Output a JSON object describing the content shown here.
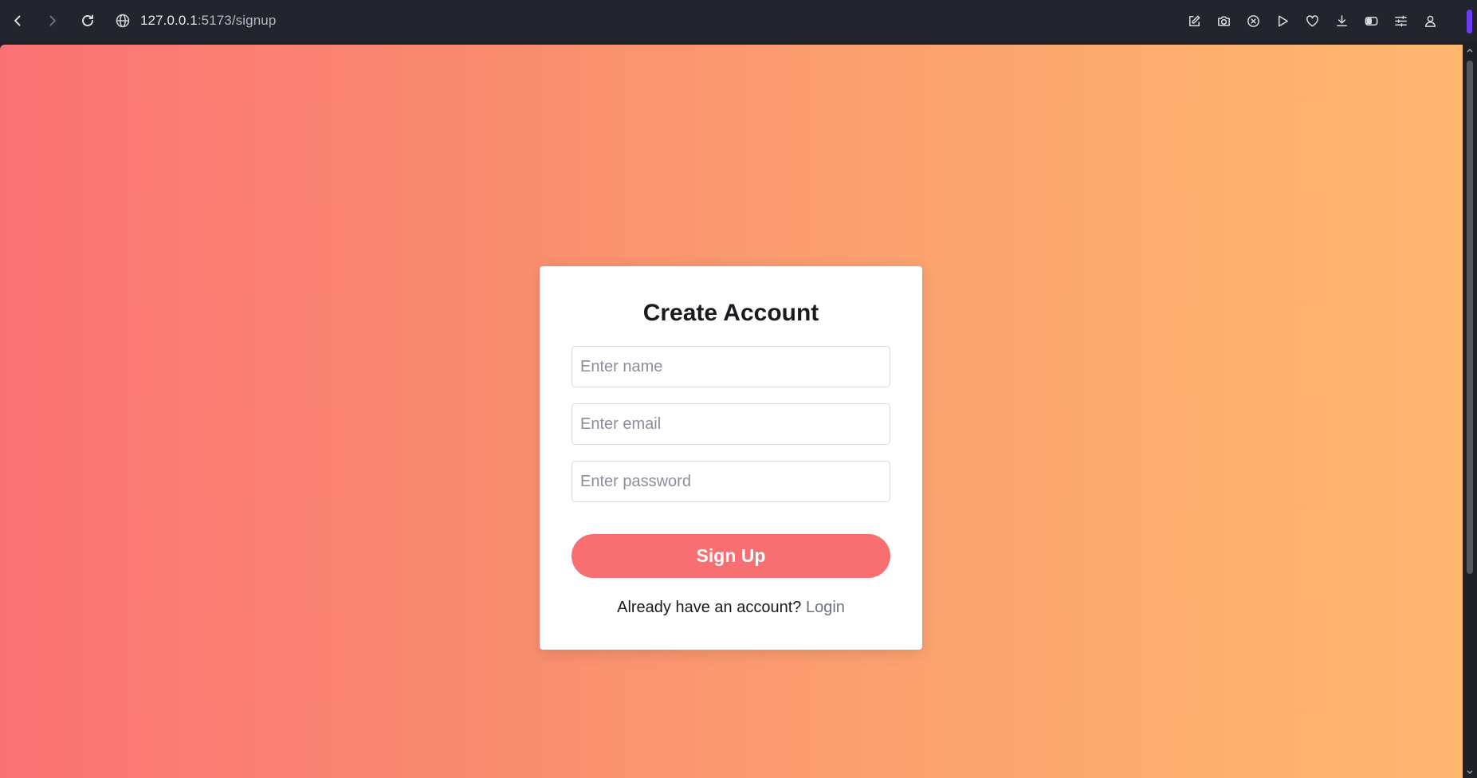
{
  "browser": {
    "url_host": "127.0.0.1",
    "url_rest": ":5173/signup",
    "nav": {
      "back_icon": "chevron-left-icon",
      "forward_icon": "chevron-right-icon",
      "reload_icon": "reload-icon",
      "site_icon": "globe-icon"
    },
    "toolbar_icons": [
      "edit-icon",
      "camera-icon",
      "shield-x-icon",
      "play-icon",
      "heart-icon",
      "download-icon",
      "toggle-icon",
      "sliders-icon",
      "user-icon"
    ],
    "accent_color": "#6c3cf5"
  },
  "page": {
    "background_colors": [
      "#fa7275",
      "#fdb86e"
    ],
    "title": "Create Account",
    "fields": {
      "name": {
        "value": "",
        "placeholder": "Enter name"
      },
      "email": {
        "value": "",
        "placeholder": "Enter email"
      },
      "password": {
        "value": "",
        "placeholder": "Enter password"
      }
    },
    "submit_label": "Sign Up",
    "submit_color": "#f76f70",
    "login_prompt": "Already have an account?",
    "login_link": "Login"
  }
}
